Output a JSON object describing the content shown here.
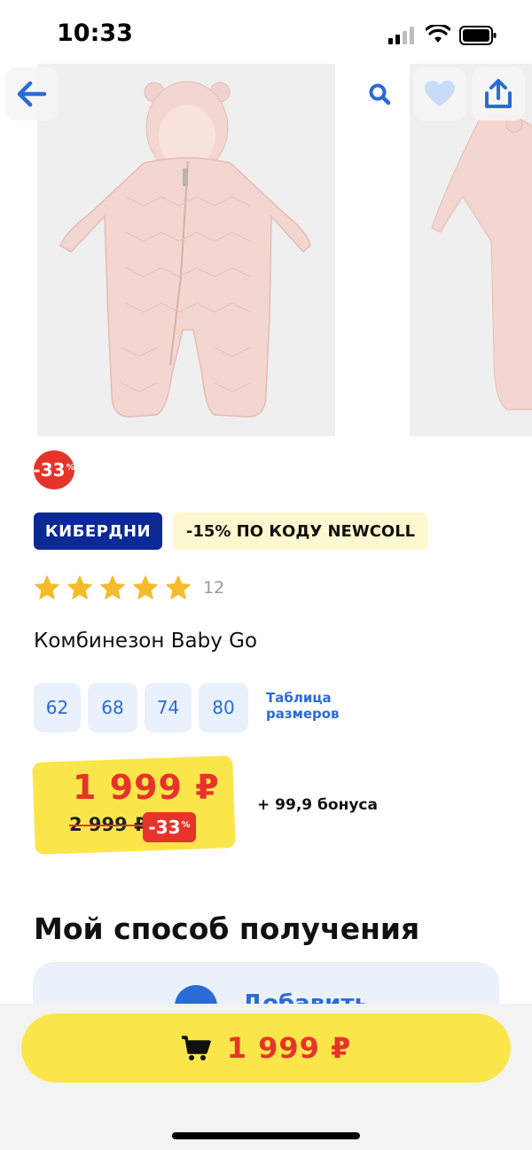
{
  "status_bar": {
    "time": "10:33"
  },
  "gallery": {
    "actions": {
      "back": "arrow-left-icon",
      "search": "search-icon",
      "favorite": "heart-icon",
      "share": "share-icon"
    }
  },
  "product": {
    "discount_badge": {
      "value": "-33",
      "unit": "%"
    },
    "promo_tags": [
      "КИБЕРДНИ",
      "-15% ПО КОДУ NEWCOLL"
    ],
    "rating": {
      "stars": 5,
      "reviews": "12"
    },
    "title": "Комбинезон Baby Go",
    "sizes": [
      "62",
      "68",
      "74",
      "80"
    ],
    "size_table_label": "Таблица размеров",
    "price": {
      "current": "1 999 ₽",
      "old": "2 999 ₽",
      "discount": "-33",
      "discount_unit": "%"
    },
    "bonus": "+ 99,9 бонуса"
  },
  "delivery": {
    "title": "Мой способ получения",
    "add_label": "Добавить"
  },
  "bottom_bar": {
    "buy_price": "1 999 ₽"
  },
  "colors": {
    "accent_blue": "#2b6bd6",
    "promo_navy": "#0b2a94",
    "price_red": "#e6342a",
    "price_yellow": "#fae64b"
  }
}
